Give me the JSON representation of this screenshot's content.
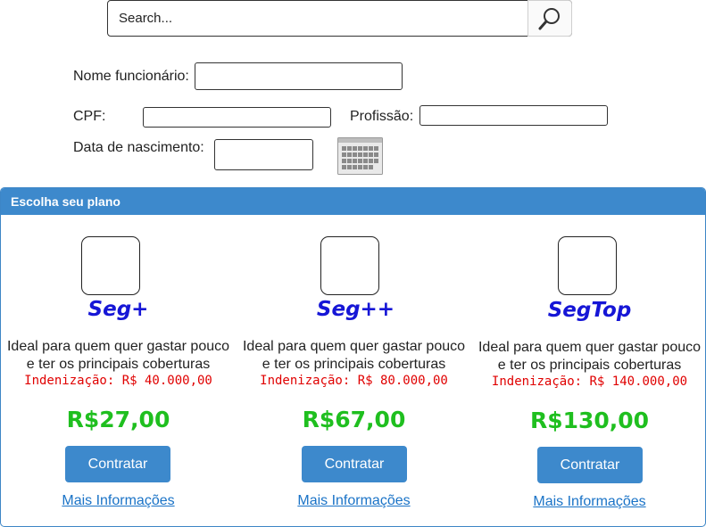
{
  "search": {
    "placeholder": "Search..."
  },
  "form": {
    "name_label": "Nome funcionário:",
    "cpf_label": "CPF:",
    "profession_label": "Profissão:",
    "birth_label": "Data de nascimento:",
    "name_value": "",
    "cpf_value": "",
    "profession_value": "",
    "birth_value": ""
  },
  "panel": {
    "title": "Escolha seu plano",
    "plans": [
      {
        "name": "Seg+",
        "desc_line1": "Ideal para quem quer gastar pouco",
        "desc_line2": "e ter os principais coberturas",
        "indemnity": "Indenização: R$ 40.000,00",
        "price": "R$27,00",
        "button": "Contratar",
        "link": "Mais Informações"
      },
      {
        "name": "Seg++",
        "desc_line1": "Ideal para quem quer gastar pouco",
        "desc_line2": "e ter os principais coberturas",
        "indemnity": "Indenização: R$ 80.000,00",
        "price": "R$67,00",
        "button": "Contratar",
        "link": "Mais Informações"
      },
      {
        "name": "SegTop",
        "desc_line1": "Ideal para quem quer gastar pouco",
        "desc_line2": "e ter os principais coberturas",
        "indemnity": "Indenização: R$ 140.000,00",
        "price": "R$130,00",
        "button": "Contratar",
        "link": "Mais Informações"
      }
    ]
  },
  "colors": {
    "accent": "#3d89cc",
    "plan_name": "#1616d6",
    "price": "#1fbf1f",
    "indemnity": "#e00000",
    "link": "#1a73c7"
  },
  "icons": {
    "search": "search-icon",
    "calendar": "calendar-icon"
  }
}
